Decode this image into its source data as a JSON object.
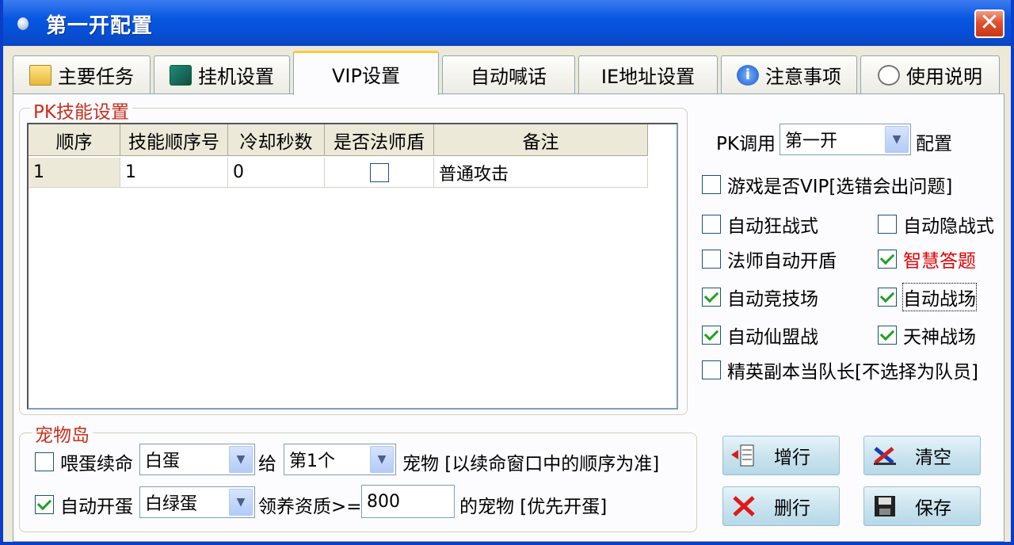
{
  "window": {
    "title": "第一开配置"
  },
  "tabs": [
    {
      "label": "主要任务",
      "icon": "folder-icon"
    },
    {
      "label": "挂机设置",
      "icon": "plugin-icon"
    },
    {
      "label": "VIP设置",
      "icon": ""
    },
    {
      "label": "自动喊话",
      "icon": ""
    },
    {
      "label": "IE地址设置",
      "icon": ""
    },
    {
      "label": "注意事项",
      "icon": "info-icon"
    },
    {
      "label": "使用说明",
      "icon": "chat-icon"
    }
  ],
  "active_tab": "VIP设置",
  "pk_group": {
    "legend": "PK技能设置",
    "columns": [
      "顺序",
      "技能顺序号",
      "冷却秒数",
      "是否法师盾",
      "备注"
    ],
    "rows": [
      {
        "order": "1",
        "skill_no": "1",
        "cooldown": "0",
        "mage_shield": false,
        "note": "普通攻击"
      }
    ]
  },
  "right_panel": {
    "pk_label": "PK调用",
    "pk_select": "第一开",
    "pk_suffix": "配置",
    "options": {
      "game_vip": {
        "label": "游戏是否VIP[选错会出问题]",
        "checked": false
      },
      "auto_berserk": {
        "label": "自动狂战式",
        "checked": false
      },
      "auto_stealth": {
        "label": "自动隐战式",
        "checked": false
      },
      "mage_shield": {
        "label": "法师自动开盾",
        "checked": false
      },
      "wisdom_quiz": {
        "label": "智慧答题",
        "checked": true
      },
      "auto_arena": {
        "label": "自动竞技场",
        "checked": true
      },
      "auto_battlefield": {
        "label": "自动战场",
        "checked": true
      },
      "auto_alliance": {
        "label": "自动仙盟战",
        "checked": true
      },
      "god_battlefield": {
        "label": "天神战场",
        "checked": true
      },
      "elite_leader": {
        "label": "精英副本当队长[不选择为队员]",
        "checked": false
      }
    }
  },
  "pet_group": {
    "legend": "宠物岛",
    "feed": {
      "label": "喂蛋续命",
      "checked": false,
      "egg": "白蛋",
      "give": "给",
      "pet_index": "第1个",
      "suffix": "宠物 [以续命窗口中的顺序为准]"
    },
    "hatch": {
      "label": "自动开蛋",
      "checked": true,
      "egg": "白绿蛋",
      "quality_label": "领养资质>=",
      "quality": "800",
      "suffix": "的宠物 [优先开蛋]"
    }
  },
  "buttons": {
    "add_row": "增行",
    "clear": "清空",
    "delete_row": "删行",
    "save": "保存"
  }
}
